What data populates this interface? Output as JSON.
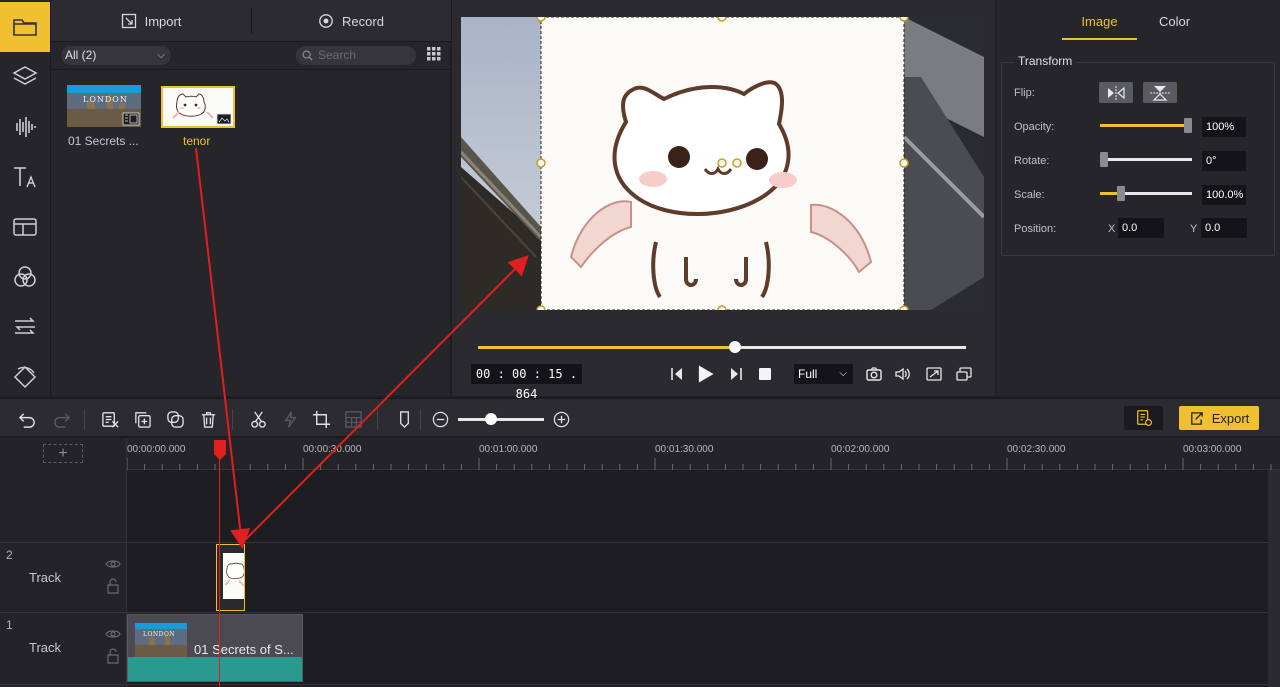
{
  "media": {
    "import_label": "Import",
    "record_label": "Record",
    "filter_value": "All (2)",
    "search_placeholder": "Search",
    "items": [
      {
        "label": "01 Secrets ...",
        "thumb_text": "LONDON"
      },
      {
        "label": "tenor"
      }
    ]
  },
  "preview": {
    "timecode": "00 : 00 : 15 . 864",
    "zoom": "Full",
    "progress": 0.527
  },
  "props": {
    "tabs": [
      "Image",
      "Color"
    ],
    "transform_title": "Transform",
    "flip_label": "Flip:",
    "opacity_label": "Opacity:",
    "opacity_value": "100%",
    "opacity_level": 1.0,
    "rotate_label": "Rotate:",
    "rotate_value": "0°",
    "rotate_level": 0.0,
    "scale_label": "Scale:",
    "scale_value": "100.0%",
    "scale_level": 0.23,
    "position_label": "Position:",
    "x_label": "X",
    "x_value": "0.0",
    "y_label": "Y",
    "y_value": "0.0"
  },
  "toolbar": {
    "export_label": "Export",
    "zoom_level": 0.38
  },
  "timeline": {
    "ticks": [
      "00:00:00.000",
      "00:00:30.000",
      "00:01:00.000",
      "00:01:30.000",
      "00:02:00.000",
      "00:02:30.000",
      "00:03:00.000"
    ],
    "add_track": "+",
    "tracks": [
      {
        "num": "2",
        "name": "Track"
      },
      {
        "num": "1",
        "name": "Track"
      }
    ],
    "clip_main_label": "01 Secrets of S...",
    "clip_thumb_text": "LONDON"
  },
  "colors": {
    "accent": "#f0c030",
    "playhead": "#e02020",
    "waveform": "#2a9a90"
  }
}
